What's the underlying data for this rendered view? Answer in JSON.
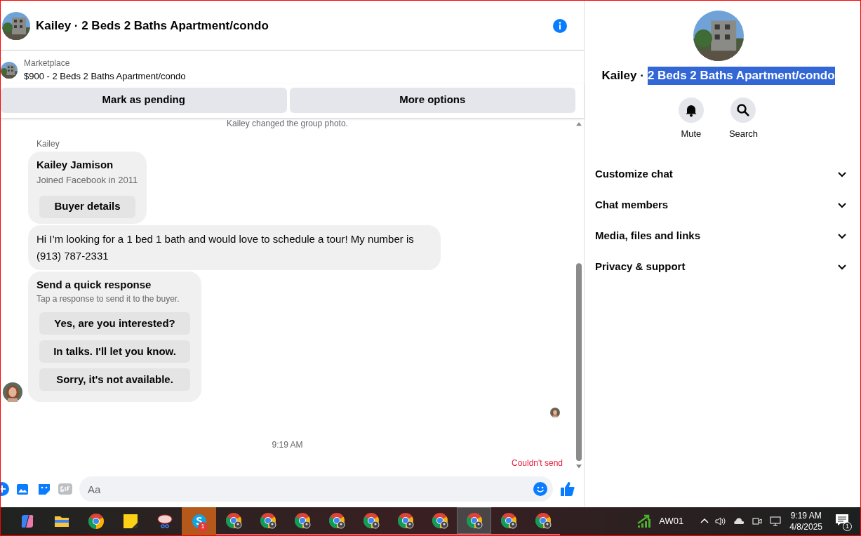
{
  "chat": {
    "title": "Kailey · 2 Beds 2 Baths Apartment/condo",
    "listing": {
      "source": "Marketplace",
      "name": "$900 - 2 Beds 2 Baths Apartment/condo"
    },
    "actions": [
      "Mark as pending",
      "More options"
    ],
    "system_note": "Kailey changed the group photo.",
    "sender": "Kailey",
    "profile": {
      "name": "Kailey Jamison",
      "joined": "Joined Facebook in 2011",
      "button": "Buyer details"
    },
    "message": "Hi I’m looking for a 1 bed 1 bath and would love to schedule a tour! My number is (913) 787-2331",
    "quick": {
      "title": "Send a quick response",
      "hint": "Tap a response to send it to the buyer.",
      "options": [
        "Yes, are you interested?",
        "In talks. I'll let you know.",
        "Sorry, it's not available."
      ]
    },
    "time": "9:19 AM",
    "error": "Couldn't send",
    "composer": {
      "placeholder": "Aa"
    }
  },
  "details": {
    "title_prefix": "Kailey ·",
    "title_rest": "2 Beds 2 Baths Apartment/condo",
    "title_selected": true,
    "actions": [
      {
        "kind": "mute",
        "label": "Mute"
      },
      {
        "kind": "search",
        "label": "Search"
      }
    ],
    "sections": [
      {
        "label": "Customize chat",
        "expanded": false
      },
      {
        "label": "Chat members",
        "expanded": false
      },
      {
        "label": "Media, files and links",
        "expanded": false
      },
      {
        "label": "Privacy & support",
        "expanded": false
      }
    ]
  },
  "taskbar": {
    "apps": [
      {
        "kind": "copilot",
        "selected": false,
        "attention": false
      },
      {
        "kind": "folder",
        "selected": false,
        "attention": false
      },
      {
        "kind": "chrome",
        "selected": false,
        "attention": false
      },
      {
        "kind": "notes",
        "selected": false,
        "attention": false
      },
      {
        "kind": "snip",
        "selected": false,
        "attention": false
      },
      {
        "kind": "skype",
        "selected": false,
        "attention": true,
        "badge": "1"
      },
      {
        "kind": "chrome-profile",
        "selected": false,
        "attention": false
      },
      {
        "kind": "chrome-profile",
        "selected": false,
        "attention": false
      },
      {
        "kind": "chrome-profile",
        "selected": false,
        "attention": false
      },
      {
        "kind": "chrome-profile",
        "selected": false,
        "attention": false
      },
      {
        "kind": "chrome-profile",
        "selected": false,
        "attention": false
      },
      {
        "kind": "chrome-profile",
        "selected": false,
        "attention": false
      },
      {
        "kind": "chrome-profile",
        "selected": false,
        "attention": false
      },
      {
        "kind": "chrome-profile",
        "selected": true,
        "attention": false
      },
      {
        "kind": "chrome-profile",
        "selected": false,
        "attention": false
      },
      {
        "kind": "chrome-profile",
        "selected": false,
        "attention": false
      }
    ],
    "network": "AW01",
    "clock_time": "9:19 AM",
    "clock_date": "4/8/2025",
    "notifications": "1"
  }
}
